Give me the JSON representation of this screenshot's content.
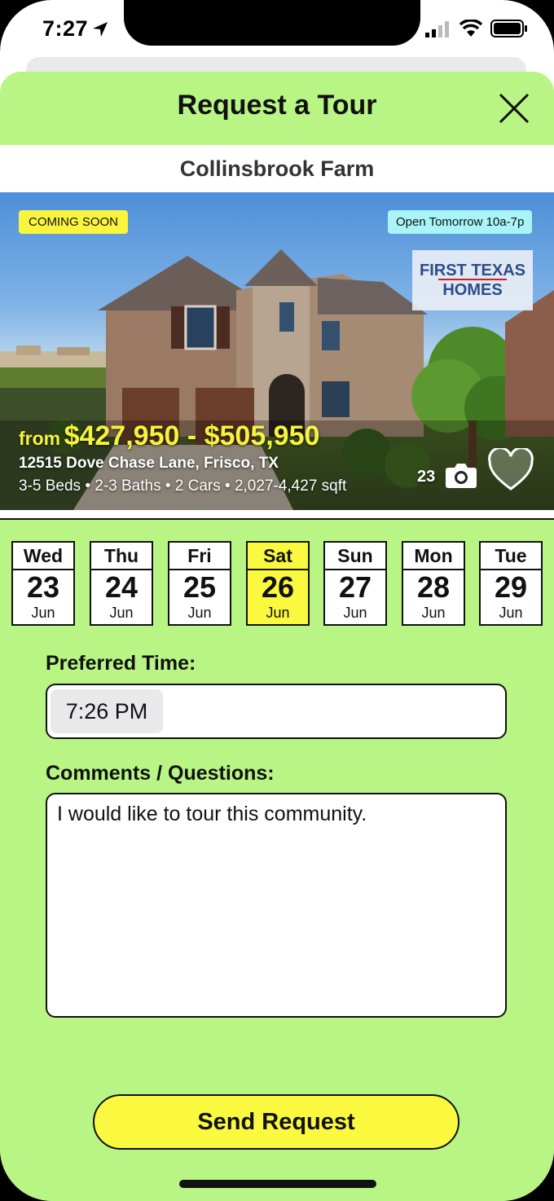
{
  "status_bar": {
    "time": "7:27"
  },
  "sheet": {
    "title": "Request a Tour",
    "close_icon": "close-icon"
  },
  "community": {
    "name": "Collinsbrook Farm"
  },
  "listing": {
    "badge_left": "COMING SOON",
    "badge_right": "Open Tomorrow 10a-7p",
    "builder_logo_line1": "FIRST TEXAS",
    "builder_logo_line2": "HOMES",
    "price_prefix": "from",
    "price_range": "$427,950 - $505,950",
    "address": "12515 Dove Chase Lane, Frisco, TX",
    "specs": "3-5 Beds • 2-3 Baths • 2 Cars • 2,027-4,427 sqft",
    "photo_count": "23",
    "icons": [
      "camera-icon",
      "heart-icon"
    ]
  },
  "dates": [
    {
      "dow": "Wed",
      "day": "23",
      "month": "Jun",
      "selected": false
    },
    {
      "dow": "Thu",
      "day": "24",
      "month": "Jun",
      "selected": false
    },
    {
      "dow": "Fri",
      "day": "25",
      "month": "Jun",
      "selected": false
    },
    {
      "dow": "Sat",
      "day": "26",
      "month": "Jun",
      "selected": true
    },
    {
      "dow": "Sun",
      "day": "27",
      "month": "Jun",
      "selected": false
    },
    {
      "dow": "Mon",
      "day": "28",
      "month": "Jun",
      "selected": false
    },
    {
      "dow": "Tue",
      "day": "29",
      "month": "Jun",
      "selected": false
    }
  ],
  "form": {
    "time_label": "Preferred Time:",
    "time_value": "7:26 PM",
    "comments_label": "Comments / Questions:",
    "comments_value": "I would like to tour this community."
  },
  "actions": {
    "send_label": "Send Request"
  },
  "colors": {
    "sheet_background": "#b8f585",
    "accent_yellow": "#fbf93f",
    "badge_cyan": "#a8f4f7"
  }
}
